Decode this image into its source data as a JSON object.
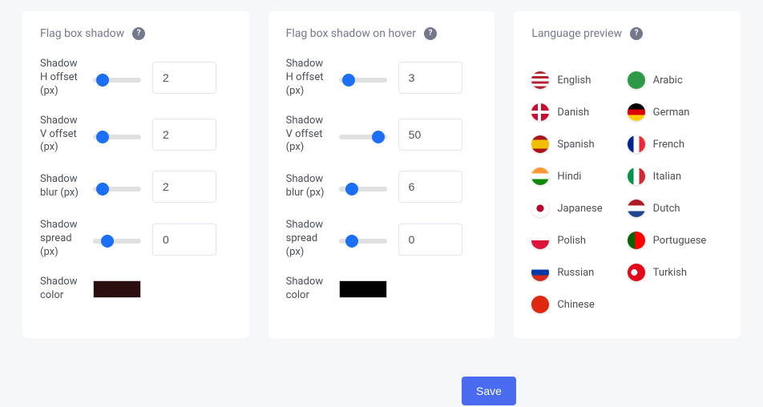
{
  "panels": {
    "shadow": {
      "title": "Flag box shadow",
      "fields": [
        {
          "label": "Shadow H offset (px)",
          "value": "2",
          "slider": 8
        },
        {
          "label": "Shadow V offset (px)",
          "value": "2",
          "slider": 8
        },
        {
          "label": "Shadow blur (px)",
          "value": "2",
          "slider": 10
        },
        {
          "label": "Shadow spread (px)",
          "value": "0",
          "slider": 22
        }
      ],
      "color_label": "Shadow color",
      "color": "#2b0f0f"
    },
    "shadow_hover": {
      "title": "Flag box shadow on hover",
      "fields": [
        {
          "label": "Shadow H offset (px)",
          "value": "3",
          "slider": 10
        },
        {
          "label": "Shadow V offset (px)",
          "value": "50",
          "slider": 95
        },
        {
          "label": "Shadow blur (px)",
          "value": "6",
          "slider": 18
        },
        {
          "label": "Shadow spread (px)",
          "value": "0",
          "slider": 20
        }
      ],
      "color_label": "Shadow color",
      "color": "#000000"
    },
    "preview": {
      "title": "Language preview",
      "languages": [
        {
          "name": "English",
          "flag": "us"
        },
        {
          "name": "Arabic",
          "flag": "ar"
        },
        {
          "name": "Danish",
          "flag": "dk"
        },
        {
          "name": "German",
          "flag": "de"
        },
        {
          "name": "Spanish",
          "flag": "es"
        },
        {
          "name": "French",
          "flag": "fr"
        },
        {
          "name": "Hindi",
          "flag": "in"
        },
        {
          "name": "Italian",
          "flag": "it"
        },
        {
          "name": "Japanese",
          "flag": "jp"
        },
        {
          "name": "Dutch",
          "flag": "nl"
        },
        {
          "name": "Polish",
          "flag": "pl"
        },
        {
          "name": "Portuguese",
          "flag": "pt"
        },
        {
          "name": "Russian",
          "flag": "ru"
        },
        {
          "name": "Turkish",
          "flag": "tr"
        },
        {
          "name": "Chinese",
          "flag": "cn"
        }
      ]
    }
  },
  "actions": {
    "save": "Save"
  },
  "flag_styles": {
    "us": "background: linear-gradient(#b22234 0 14%, #fff 14% 28%, #b22234 28% 42%, #fff 42% 56%, #b22234 56% 70%, #fff 70% 84%, #b22234 84% 100%); position:relative;",
    "ar": "background:#2e9a47;",
    "dk": "background:#c8102e; background-image: linear-gradient(#fff,#fff), linear-gradient(#fff,#fff); background-size: 4px 100%, 100% 4px; background-position: 8px 0, 0 50%; background-repeat:no-repeat;",
    "de": "background: linear-gradient(#000 0 33%, #dd0000 33% 66%, #ffce00 66% 100%);",
    "es": "background: linear-gradient(#aa151b 0 25%, #f1bf00 25% 75%, #aa151b 75% 100%);",
    "fr": "background: linear-gradient(90deg,#002395 0 33%, #fff 33% 66%, #ed2939 66% 100%);",
    "in": "background: linear-gradient(#ff9933 0 33%, #fff 33% 66%, #138808 66% 100%);",
    "it": "background: linear-gradient(90deg,#009246 0 33%, #fff 33% 66%, #ce2b37 66% 100%);",
    "jp": "background:#fff radial-gradient(circle at center, #bc002d 0 28%, transparent 29%);",
    "nl": "background: linear-gradient(#ae1c28 0 33%, #fff 33% 66%, #21468b 66% 100%);",
    "pl": "background: linear-gradient(#fff 0 50%, #dc143c 50% 100%);",
    "pt": "background: linear-gradient(90deg,#006600 0 40%, #ff0000 40% 100%);",
    "ru": "background: linear-gradient(#fff 0 33%, #0039a6 33% 66%, #d52b1e 66% 100%);",
    "tr": "background:#e30a17 radial-gradient(circle at 38% 50%, #fff 0 22%, transparent 23%);",
    "cn": "background:#de2910;"
  }
}
